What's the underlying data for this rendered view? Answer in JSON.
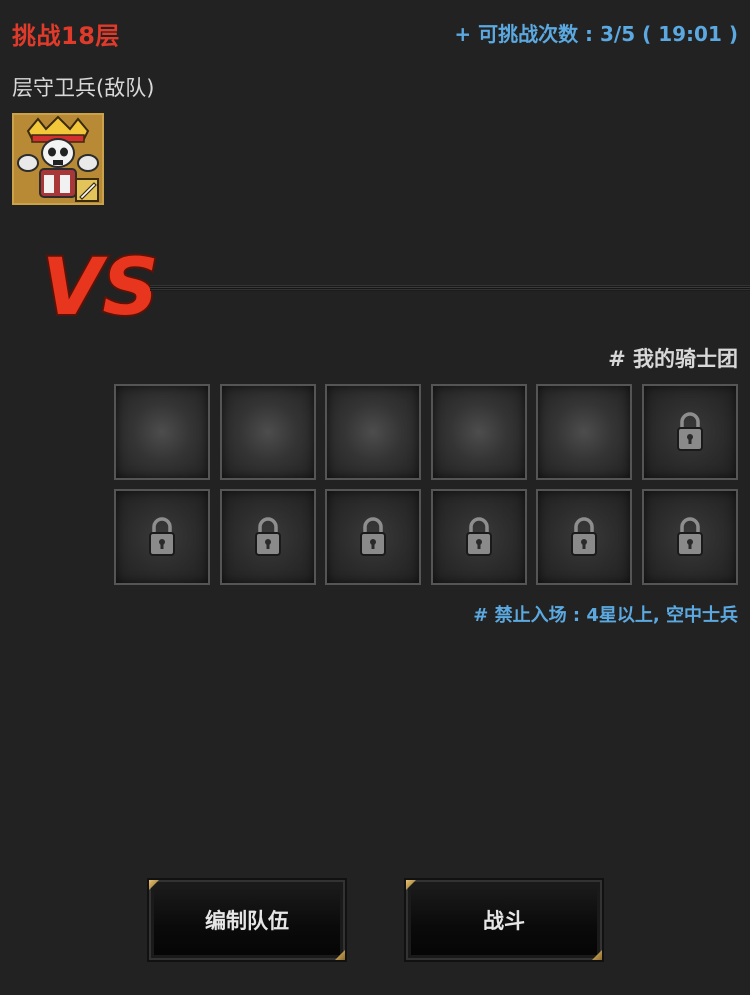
{
  "header": {
    "title": "挑战18层",
    "attempts": "+ 可挑战次数 : 3/5 ( 19:01 )"
  },
  "enemy": {
    "label": "层守卫兵(敌队)"
  },
  "vs": {
    "text": "VS"
  },
  "my_team": {
    "label": "# 我的骑士团",
    "slots": [
      {
        "locked": false
      },
      {
        "locked": false
      },
      {
        "locked": false
      },
      {
        "locked": false
      },
      {
        "locked": false
      },
      {
        "locked": true
      },
      {
        "locked": true
      },
      {
        "locked": true
      },
      {
        "locked": true
      },
      {
        "locked": true
      },
      {
        "locked": true
      },
      {
        "locked": true
      }
    ],
    "restriction": "# 禁止入场 : 4星以上, 空中士兵"
  },
  "buttons": {
    "edit_team": "编制队伍",
    "fight": "战斗"
  },
  "colors": {
    "title": "#e03a2a",
    "accent_blue": "#5ba9e0",
    "vs_red": "#e8351e",
    "gold": "#c9a24a"
  }
}
